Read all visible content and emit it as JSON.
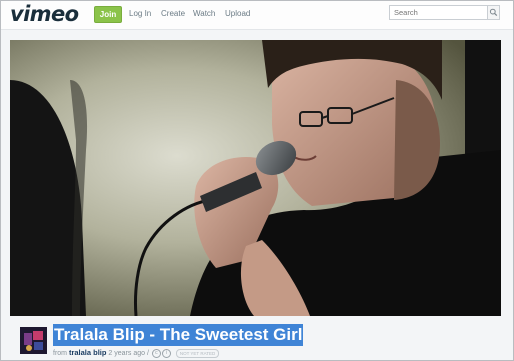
{
  "header": {
    "logo_text": "vimeo",
    "join_label": "Join",
    "nav": {
      "login": "Log In",
      "create": "Create",
      "watch": "Watch",
      "upload": "Upload"
    },
    "search_placeholder": "Search"
  },
  "video": {
    "title": "Tralala Blip - The Sweetest Girl",
    "byline_prefix": "from",
    "author": "tralala blip",
    "posted": "2 years ago",
    "separator": "/",
    "license_badge": "NOT YET RATED"
  },
  "colors": {
    "brand": "#1a2e3b",
    "join": "#8bc34a",
    "title_highlight": "#3f84d6",
    "author_link": "#1d3e63"
  },
  "icons": [
    "search-icon",
    "creative-commons-icon",
    "attribution-icon"
  ]
}
